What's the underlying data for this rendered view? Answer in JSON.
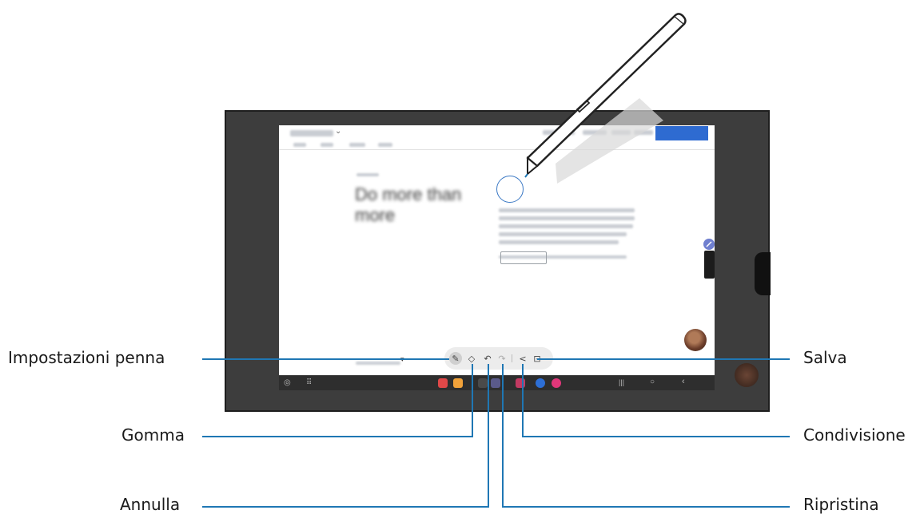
{
  "screen_page": {
    "headline": "Do more than more",
    "cta_label": "",
    "blurred_note": "Text and controls in the captured screen are blurred and unreadable"
  },
  "callouts": {
    "pen_settings": "Impostazioni penna",
    "eraser": "Gomma",
    "undo": "Annulla",
    "save": "Salva",
    "share": "Condivisione",
    "redo": "Ripristina"
  },
  "toolbar_icons": [
    "pen-settings-icon",
    "eraser-icon",
    "undo-icon",
    "redo-icon",
    "share-icon",
    "save-icon"
  ],
  "colors": {
    "leader_lines": "#1f77b4",
    "accent_button": "#2e6bd1",
    "tablet_frame": "#3d3d3d"
  }
}
